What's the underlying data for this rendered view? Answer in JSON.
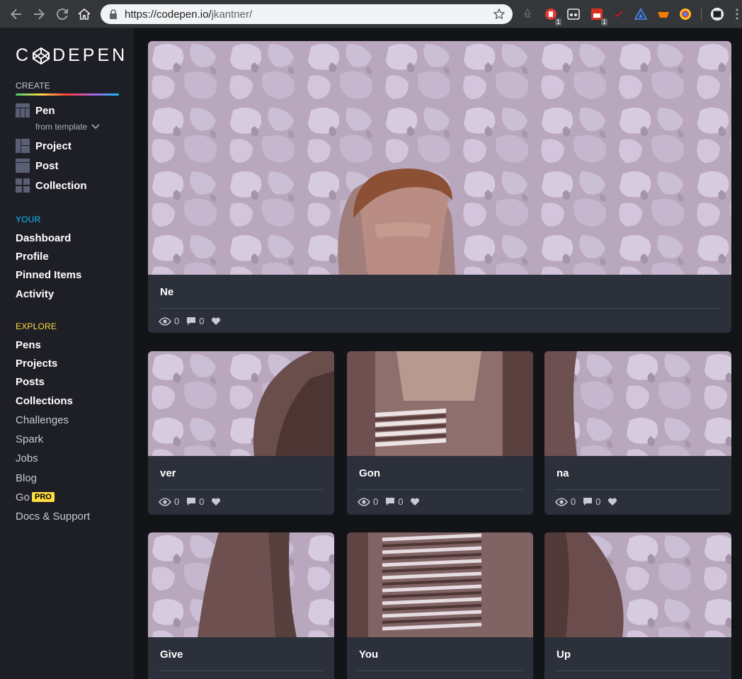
{
  "browser": {
    "url_host": "https://codepen.io/",
    "url_path": "jkantner/",
    "extension_badges": [
      "1",
      "1"
    ]
  },
  "sidebar": {
    "logo_text_left": "C",
    "logo_text_right": "DEPEN",
    "create_heading": "CREATE",
    "create_items": [
      {
        "label": "Pen",
        "icon": "pen-icon"
      },
      {
        "label": "Project",
        "icon": "project-icon"
      },
      {
        "label": "Post",
        "icon": "post-icon"
      },
      {
        "label": "Collection",
        "icon": "collection-icon"
      }
    ],
    "from_template": "from template",
    "your_heading": "YOUR",
    "your_items": [
      "Dashboard",
      "Profile",
      "Pinned Items",
      "Activity"
    ],
    "explore_heading": "EXPLORE",
    "explore_bold": [
      "Pens",
      "Projects",
      "Posts",
      "Collections"
    ],
    "explore_light": [
      "Challenges",
      "Spark",
      "Jobs",
      "Blog",
      "Go",
      "Docs & Support"
    ],
    "pro_badge": "PRO",
    "colors": {
      "your": "#0ebeff",
      "explore": "#ffdd40",
      "pro": "#ffdd40"
    }
  },
  "cards": [
    {
      "title": "Ne",
      "views": "0",
      "comments": "0"
    },
    {
      "title": "ver",
      "views": "0",
      "comments": "0"
    },
    {
      "title": "Gon",
      "views": "0",
      "comments": "0"
    },
    {
      "title": "na",
      "views": "0",
      "comments": "0"
    },
    {
      "title": "Give"
    },
    {
      "title": "You"
    },
    {
      "title": "Up"
    }
  ]
}
